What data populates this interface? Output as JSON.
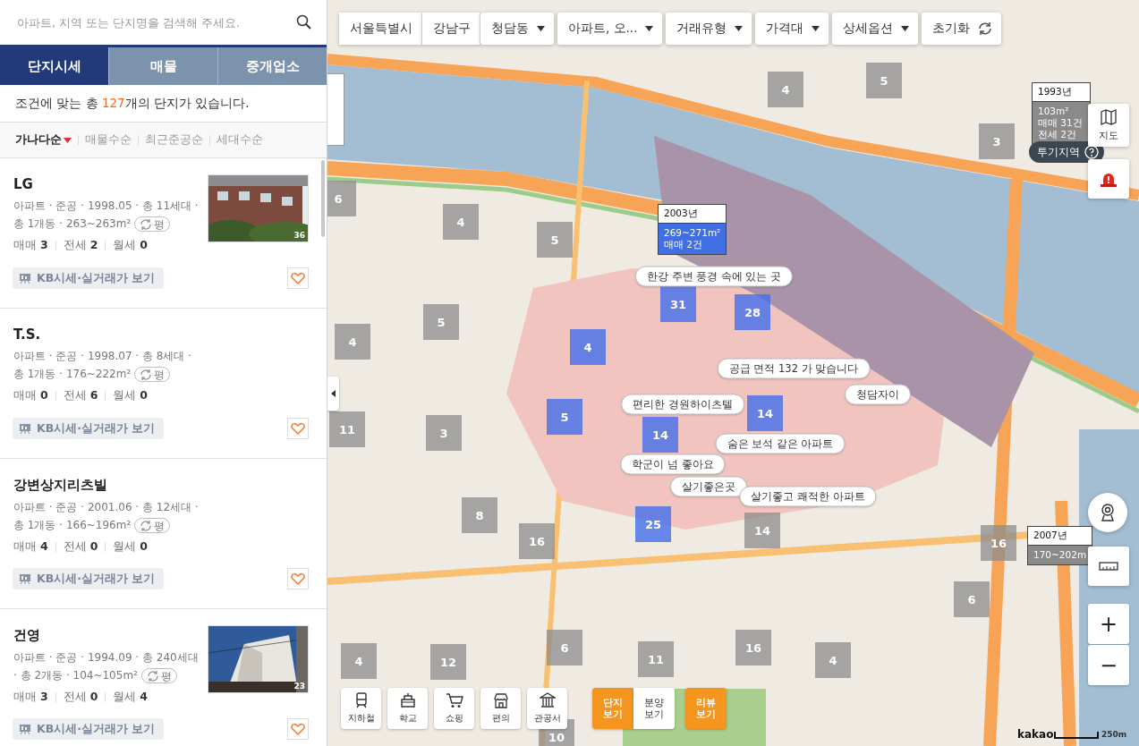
{
  "search": {
    "placeholder": "아파트, 지역 또는 단지명을 검색해 주세요."
  },
  "tabs": [
    {
      "label": "단지시세",
      "selected": true
    },
    {
      "label": "매물",
      "selected": false
    },
    {
      "label": "중개업소",
      "selected": false
    }
  ],
  "result_summary": "조건에 맞는 총 **127**개의 단지가 있습니다.",
  "sort_options": [
    {
      "label": "가나다순",
      "selected": true
    },
    {
      "label": "매물수순",
      "selected": false
    },
    {
      "label": "최근준공순",
      "selected": false
    },
    {
      "label": "세대수순",
      "selected": false
    }
  ],
  "complexes": [
    {
      "name": "LG",
      "info": "아파트 · 준공 · 1998.05 · 총 11세대 · 총 1개동 · 263~263m²",
      "unit_toggle": "평",
      "counts": [
        {
          "label": "매매",
          "value": "3"
        },
        {
          "label": "전세",
          "value": "2"
        },
        {
          "label": "월세",
          "value": "0"
        }
      ],
      "kb_button": "KB시세·실거래가 보기",
      "photo": {
        "kind": "picture",
        "count": "36"
      }
    },
    {
      "name": "T.S.",
      "info": "아파트 · 준공 · 1998.07 · 총 8세대 · 총 1개동 · 176~222m²",
      "unit_toggle": "평",
      "counts": [
        {
          "label": "매매",
          "value": "0"
        },
        {
          "label": "전세",
          "value": "6"
        },
        {
          "label": "월세",
          "value": "0"
        }
      ],
      "kb_button": "KB시세·실거래가 보기"
    },
    {
      "name": "강변상지리츠빌",
      "info": "아파트 · 준공 · 2001.06 · 총 12세대 · 총 1개동 · 166~196m²",
      "unit_toggle": "평",
      "counts": [
        {
          "label": "매매",
          "value": "4"
        },
        {
          "label": "전세",
          "value": "0"
        },
        {
          "label": "월세",
          "value": "0"
        }
      ],
      "kb_button": "KB시세·실거래가 보기"
    },
    {
      "name": "건영",
      "info": "아파트 · 준공 · 1994.09 · 총 240세대 · 총 2개동 · 104~105m²",
      "unit_toggle": "평",
      "counts": [
        {
          "label": "매매",
          "value": "3"
        },
        {
          "label": "전세",
          "value": "0"
        },
        {
          "label": "월세",
          "value": "4"
        }
      ],
      "kb_button": "KB시세·실거래가 보기",
      "photo": {
        "kind": "picture",
        "count": "23"
      }
    }
  ],
  "map": {
    "filters": [
      {
        "label": "서울특별시",
        "kind": "crumb"
      },
      {
        "label": "강남구",
        "kind": "crumb"
      },
      {
        "label": "청담동",
        "kind": "dropdown"
      },
      {
        "label": "아파트, 오...",
        "kind": "dropdown"
      },
      {
        "label": "거래유형",
        "kind": "dropdown"
      },
      {
        "label": "가격대",
        "kind": "dropdown"
      },
      {
        "label": "상세옵션",
        "kind": "dropdown"
      },
      {
        "label": "초기화",
        "kind": "reset"
      }
    ],
    "clusters": [
      {
        "count": "4",
        "highlighted": false
      },
      {
        "count": "5",
        "highlighted": false
      },
      {
        "count": "3",
        "highlighted": false
      },
      {
        "count": "6",
        "highlighted": false
      },
      {
        "count": "4",
        "highlighted": false
      },
      {
        "count": "5",
        "highlighted": false
      },
      {
        "count": "4",
        "highlighted": false
      },
      {
        "count": "5",
        "highlighted": false
      },
      {
        "count": "4",
        "highlighted": true
      },
      {
        "count": "31",
        "highlighted": true
      },
      {
        "count": "28",
        "highlighted": true
      },
      {
        "count": "11",
        "highlighted": false
      },
      {
        "count": "3",
        "highlighted": false
      },
      {
        "count": "5",
        "highlighted": true
      },
      {
        "count": "14",
        "highlighted": true
      },
      {
        "count": "14",
        "highlighted": true
      },
      {
        "count": "8",
        "highlighted": false
      },
      {
        "count": "16",
        "highlighted": false
      },
      {
        "count": "25",
        "highlighted": true
      },
      {
        "count": "14",
        "highlighted": false
      },
      {
        "count": "16",
        "highlighted": false
      },
      {
        "count": "6",
        "highlighted": false
      },
      {
        "count": "4",
        "highlighted": false
      },
      {
        "count": "12",
        "highlighted": false
      },
      {
        "count": "6",
        "highlighted": false
      },
      {
        "count": "11",
        "highlighted": false
      },
      {
        "count": "16",
        "highlighted": false
      },
      {
        "count": "4",
        "highlighted": false
      },
      {
        "count": "10",
        "highlighted": false
      }
    ],
    "comments": [
      "한강 주변 풍경 속에 있는 곳",
      "공급 면적 132 가 맞습니다",
      "청담자이",
      "편리한 경원하이츠텔",
      "숨은 보석 같은 아파트",
      "학군이 넘 좋아요",
      "살기좋은곳",
      "살기좋고 쾌적한 아파트"
    ],
    "tooltips": [
      {
        "year": "2003년",
        "lines": [
          "269~271m²",
          "매매 2건"
        ],
        "highlighted": true
      },
      {
        "year": "1993년",
        "lines": [
          "103m²",
          "매매 31건",
          "전세 2건"
        ],
        "highlighted": false
      },
      {
        "year": "2007년",
        "lines": [
          "170~202m"
        ],
        "highlighted": false
      }
    ],
    "zone_badge": "투기지역",
    "map_type_button": "지도",
    "amenities": [
      "지하철",
      "학교",
      "쇼핑",
      "편의",
      "관공서"
    ],
    "view_toggles": [
      {
        "label": "단지 보기",
        "selected": true
      },
      {
        "label": "분양 보기",
        "selected": false
      },
      {
        "label": "리뷰 보기",
        "selected": true
      }
    ],
    "zoom": [
      "+",
      "−"
    ],
    "brand": "kakao",
    "scale": "250m"
  }
}
